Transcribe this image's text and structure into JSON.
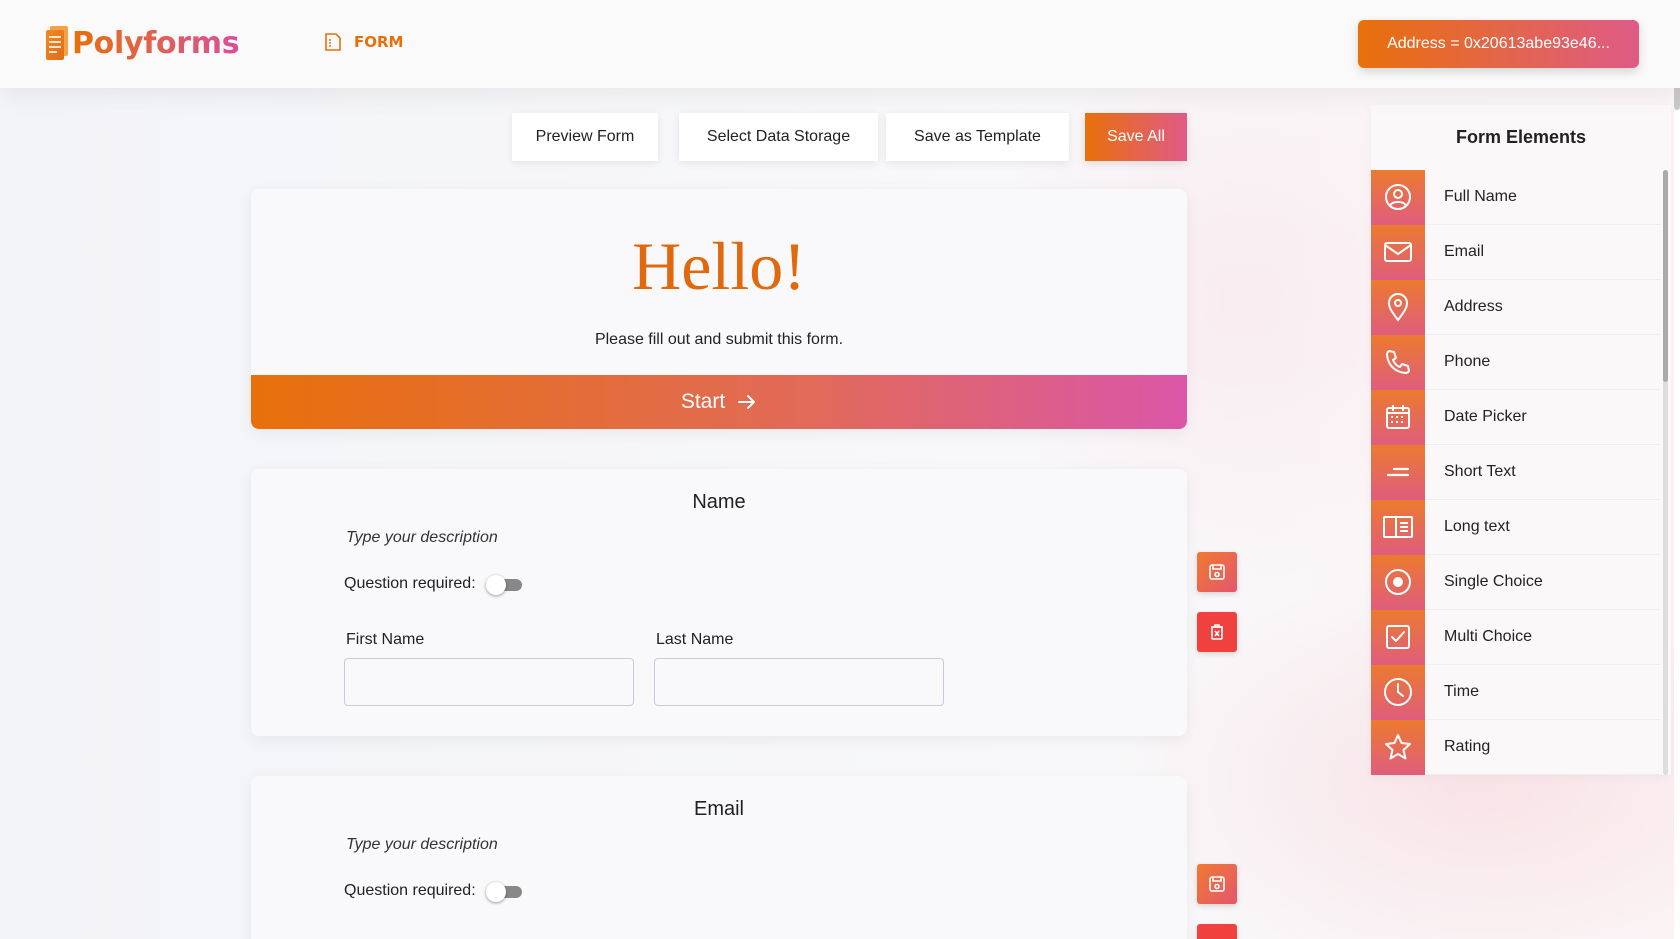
{
  "header": {
    "brand": "Polyforms",
    "nav_label": "FORM",
    "address_label": "Address = 0x20613abe93e46..."
  },
  "toolbar": {
    "preview": "Preview Form",
    "select_storage": "Select Data Storage",
    "save_template": "Save as Template",
    "save_all": "Save All"
  },
  "welcome": {
    "title": "Hello!",
    "subtitle": "Please fill out and submit this form.",
    "start_label": "Start"
  },
  "questions": [
    {
      "title": "Name",
      "description": "Type your description",
      "required_label": "Question required:",
      "fields": [
        "First Name",
        "Last Name"
      ]
    },
    {
      "title": "Email",
      "description": "Type your description",
      "required_label": "Question required:"
    }
  ],
  "panel": {
    "title": "Form Elements",
    "items": [
      {
        "label": "Full Name",
        "icon": "user-circle-icon"
      },
      {
        "label": "Email",
        "icon": "mail-icon"
      },
      {
        "label": "Address",
        "icon": "map-pin-icon"
      },
      {
        "label": "Phone",
        "icon": "phone-icon"
      },
      {
        "label": "Date Picker",
        "icon": "calendar-icon"
      },
      {
        "label": "Short Text",
        "icon": "short-text-icon"
      },
      {
        "label": "Long text",
        "icon": "long-text-icon"
      },
      {
        "label": "Single Choice",
        "icon": "radio-icon"
      },
      {
        "label": "Multi Choice",
        "icon": "checkbox-icon"
      },
      {
        "label": "Time",
        "icon": "clock-icon"
      },
      {
        "label": "Rating",
        "icon": "star-icon"
      }
    ]
  },
  "colors": {
    "accent": "#e8700a",
    "accent_pink": "#db56a8",
    "danger": "#f1413f"
  }
}
